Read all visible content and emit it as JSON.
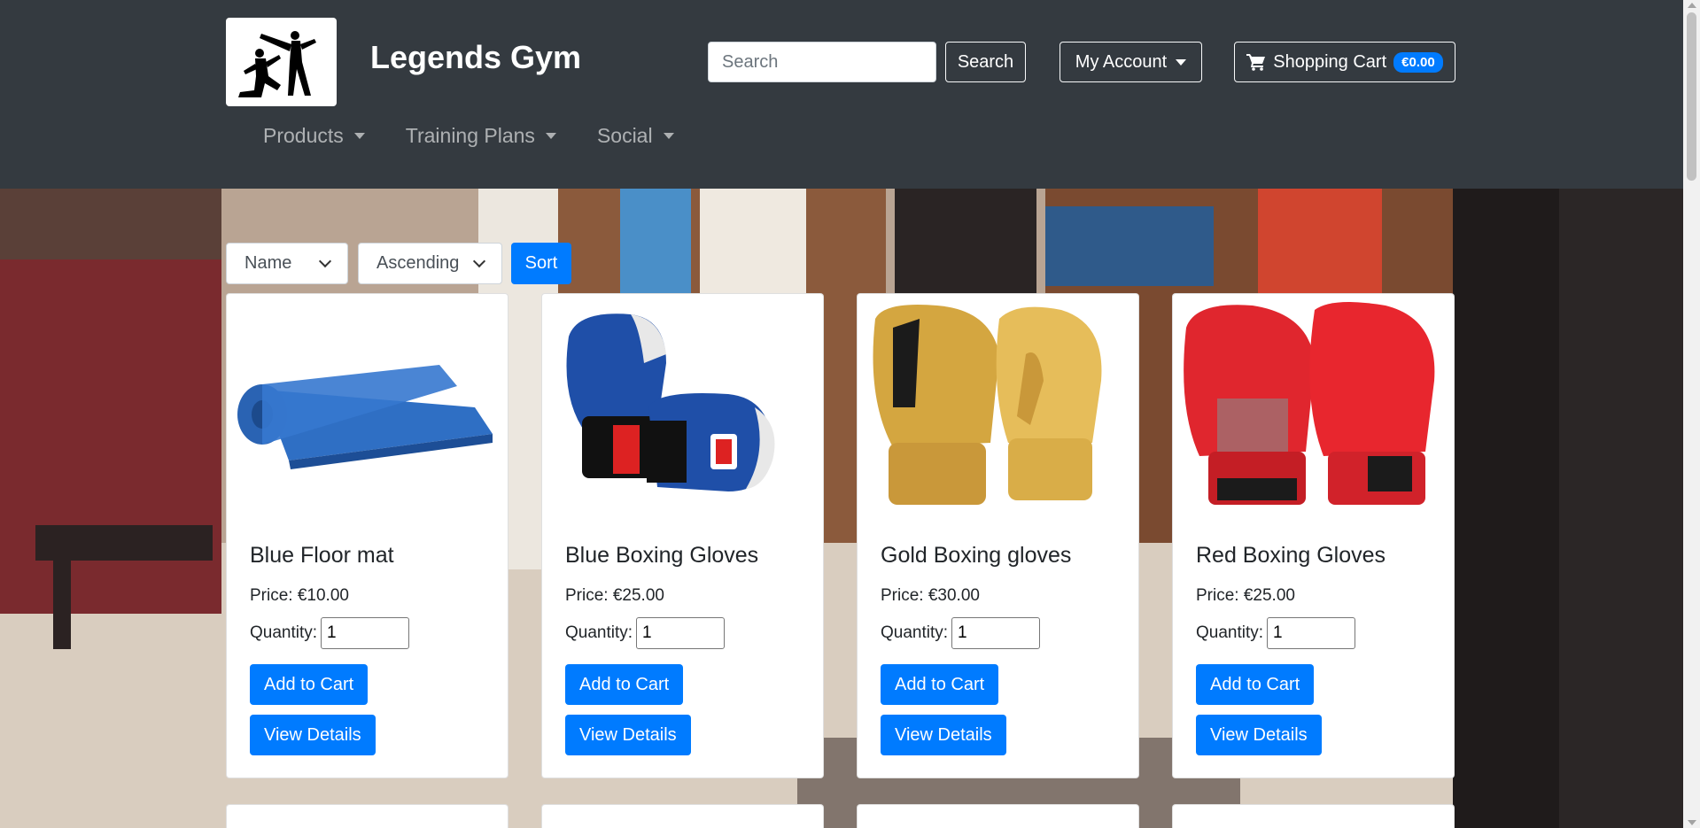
{
  "header": {
    "brand": "Legends Gym",
    "search_placeholder": "Search",
    "search_label": "Search",
    "account_label": "My Account",
    "cart_label": "Shopping Cart",
    "cart_total": "€0.00"
  },
  "nav": {
    "products": "Products",
    "training_plans": "Training Plans",
    "social": "Social"
  },
  "sort": {
    "field": "Name",
    "order": "Ascending",
    "button": "Sort"
  },
  "products": [
    {
      "name": "Blue Floor mat",
      "price": "Price: €10.00",
      "qty_label": "Quantity:",
      "qty": "1",
      "add": "Add to Cart",
      "view": "View Details"
    },
    {
      "name": "Blue Boxing Gloves",
      "price": "Price: €25.00",
      "qty_label": "Quantity:",
      "qty": "1",
      "add": "Add to Cart",
      "view": "View Details"
    },
    {
      "name": "Gold Boxing gloves",
      "price": "Price: €30.00",
      "qty_label": "Quantity:",
      "qty": "1",
      "add": "Add to Cart",
      "view": "View Details"
    },
    {
      "name": "Red Boxing Gloves",
      "price": "Price: €25.00",
      "qty_label": "Quantity:",
      "qty": "1",
      "add": "Add to Cart",
      "view": "View Details"
    }
  ],
  "colors": {
    "header_bg": "#343a40",
    "primary": "#007bff"
  },
  "icons": {
    "logo": "martial-artists-logo",
    "cart": "shopping-cart-icon"
  }
}
